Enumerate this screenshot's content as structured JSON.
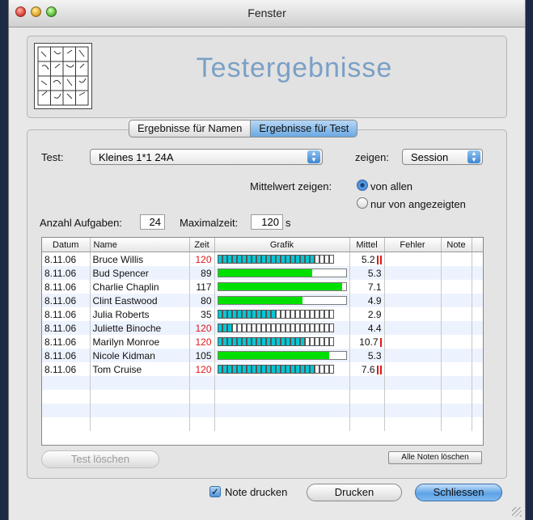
{
  "window": {
    "title": "Fenster"
  },
  "header": {
    "title": "Testergebnisse"
  },
  "tabs": [
    {
      "label": "Ergebnisse für Namen"
    },
    {
      "label": "Ergebnisse für Test"
    }
  ],
  "test": {
    "label": "Test:",
    "value": "Kleines 1*1 24A"
  },
  "show": {
    "label": "zeigen:",
    "value": "Session"
  },
  "mean": {
    "label": "Mittelwert zeigen:",
    "option_all": "von allen",
    "option_shown": "nur von angezeigten",
    "selected": "von allen"
  },
  "tasks": {
    "label": "Anzahl Aufgaben:",
    "value": "24"
  },
  "maxtime": {
    "label": "Maximalzeit:",
    "value": "120",
    "unit": "s"
  },
  "table": {
    "headers": [
      "Datum",
      "Name",
      "Zeit",
      "Grafik",
      "Mittel",
      "Fehler",
      "Note"
    ],
    "rows": [
      {
        "date": "8.11.06",
        "name": "Bruce Willis",
        "time": "120",
        "time_red": true,
        "graph": "cells",
        "cells_filled": 20,
        "mean": "5.2",
        "errors": 2
      },
      {
        "date": "8.11.06",
        "name": "Bud Spencer",
        "time": "89",
        "time_red": false,
        "graph": "bar",
        "fill": 0.74,
        "mean": "5.3",
        "errors": 0
      },
      {
        "date": "8.11.06",
        "name": "Charlie Chaplin",
        "time": "117",
        "time_red": false,
        "graph": "bar",
        "fill": 0.97,
        "mean": "7.1",
        "errors": 0
      },
      {
        "date": "8.11.06",
        "name": "Clint Eastwood",
        "time": "80",
        "time_red": false,
        "graph": "bar",
        "fill": 0.66,
        "mean": "4.9",
        "errors": 0
      },
      {
        "date": "8.11.06",
        "name": "Julia Roberts",
        "time": "35",
        "time_red": false,
        "graph": "cells",
        "cells_filled": 12,
        "mean": "2.9",
        "errors": 0
      },
      {
        "date": "8.11.06",
        "name": "Juliette Binoche",
        "time": "120",
        "time_red": true,
        "graph": "cells",
        "cells_filled": 3,
        "mean": "4.4",
        "errors": 0
      },
      {
        "date": "8.11.06",
        "name": "Marilyn Monroe",
        "time": "120",
        "time_red": true,
        "graph": "cells",
        "cells_filled": 18,
        "mean": "10.7",
        "errors": 1
      },
      {
        "date": "8.11.06",
        "name": "Nicole Kidman",
        "time": "105",
        "time_red": false,
        "graph": "bar",
        "fill": 0.87,
        "mean": "5.3",
        "errors": 0
      },
      {
        "date": "8.11.06",
        "name": "Tom Cruise",
        "time": "120",
        "time_red": true,
        "graph": "cells",
        "cells_filled": 20,
        "mean": "7.6",
        "errors": 2
      }
    ]
  },
  "buttons": {
    "delete_test": "Test löschen",
    "delete_notes": "Alle Noten löschen",
    "print_notes": "Note drucken",
    "print": "Drucken",
    "close": "Schliessen"
  },
  "colors": {
    "accent": "#3f86d3",
    "bar": "#00e000",
    "cell": "#00c8d6",
    "error": "#e01818",
    "title": "#7aa0c6"
  },
  "icons": {
    "print_check": "checkmark-icon",
    "thumb": "multiplication-grid-image"
  }
}
